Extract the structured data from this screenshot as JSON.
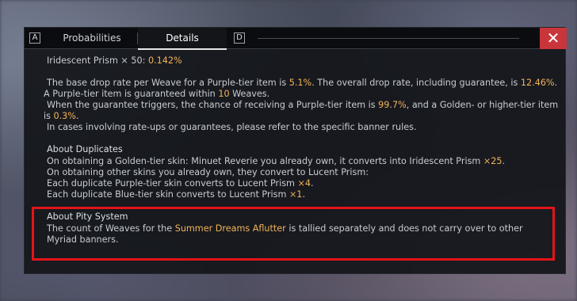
{
  "tabs": {
    "left_key": "A",
    "right_key": "D",
    "items": [
      {
        "label": "Probabilities"
      },
      {
        "label": "Details"
      }
    ]
  },
  "close_icon": "✕",
  "content": {
    "prism_line": {
      "label": "Iridescent Prism × 50:",
      "value": "0.142%"
    },
    "base_rate": {
      "t1": "The base drop rate per Weave for a Purple-tier item is ",
      "v1": "5.1%",
      "t2": ". The overall drop rate, including guarantee, is ",
      "v2": "12.46%",
      "t3": "."
    },
    "guarantee": {
      "t1": "A Purple-tier item is guaranteed within ",
      "v1": "10",
      "t2": " Weaves."
    },
    "trigger": {
      "t1": "When the guarantee triggers, the chance of receiving a Purple-tier item is ",
      "v1": "99.7%",
      "t2": ", and a Golden- or higher-tier item is ",
      "v2": "0.3%",
      "t3": "."
    },
    "rate_ups": "In cases involving rate-ups or guarantees, please refer to the specific banner rules.",
    "duplicates": {
      "heading": "About Duplicates",
      "golden": {
        "t1": "On obtaining a Golden-tier skin: Minuet Reverie you already own, it converts into Iridescent Prism ",
        "v1": "×25",
        "t2": "."
      },
      "other": "On obtaining other skins you already own, they convert to Lucent Prism:",
      "purple": {
        "t1": "Each duplicate Purple-tier skin converts to Lucent Prism ",
        "v1": "×4",
        "t2": "."
      },
      "blue": {
        "t1": "Each duplicate Blue-tier skin converts to Lucent Prism ",
        "v1": "×1",
        "t2": "."
      }
    },
    "pity": {
      "heading": "About Pity System",
      "t1": "The count of Weaves for the ",
      "banner": "Summer Dreams Aflutter",
      "t2": " is tallied separately and does not carry over to other",
      "t3": "Myriad banners."
    }
  },
  "colors": {
    "highlight": "#f2b35a",
    "close_bg": "#c8353a",
    "annotation_box": "#e3141a"
  }
}
